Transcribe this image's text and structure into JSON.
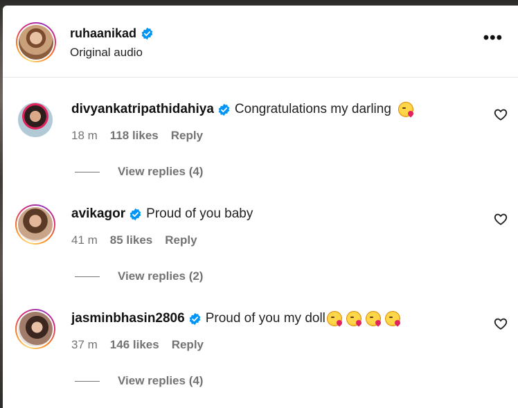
{
  "post": {
    "username": "ruhaanikad",
    "subtitle": "Original audio",
    "more_icon": "more-horizontal-icon"
  },
  "colors": {
    "verified": "#0095f6",
    "meta_text": "#737373",
    "story_ring": [
      "#feda75",
      "#fa7e1e",
      "#d62976",
      "#962fbf"
    ]
  },
  "comments": [
    {
      "username": "divyankatripathidahiya",
      "text": "Congratulations my darling",
      "emoji_count": 1,
      "time": "18 m",
      "likes": "118 likes",
      "reply": "Reply",
      "view_replies": "View replies (4)"
    },
    {
      "username": "avikagor",
      "text": "Proud of you baby",
      "emoji_count": 0,
      "time": "41 m",
      "likes": "85 likes",
      "reply": "Reply",
      "view_replies": "View replies (2)"
    },
    {
      "username": "jasminbhasin2806",
      "text": "Proud of you my doll",
      "emoji_count": 4,
      "time": "37 m",
      "likes": "146 likes",
      "reply": "Reply",
      "view_replies": "View replies (4)"
    }
  ]
}
